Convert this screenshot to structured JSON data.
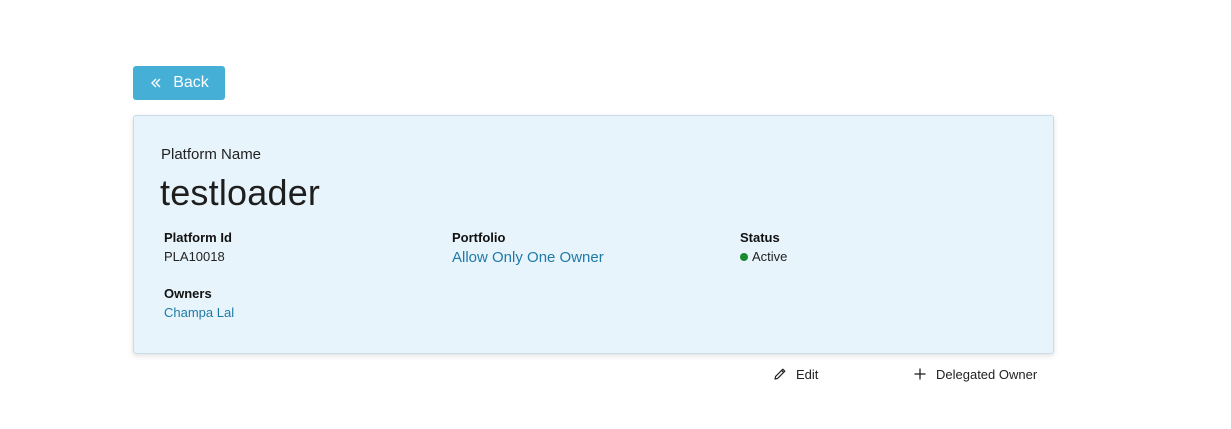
{
  "back_button": {
    "label": "Back",
    "icon": "double-chevron-left-icon"
  },
  "platform": {
    "name_label": "Platform Name",
    "name": "testloader",
    "fields": {
      "platform_id": {
        "label": "Platform Id",
        "value": "PLA10018"
      },
      "portfolio": {
        "label": "Portfolio",
        "value": "Allow Only One Owner"
      },
      "status": {
        "label": "Status",
        "value": "Active",
        "color": "#1b8a2f"
      },
      "owners": {
        "label": "Owners",
        "value": "Champa Lal"
      }
    }
  },
  "actions": {
    "edit": {
      "label": "Edit",
      "icon": "pencil-icon"
    },
    "delegated_owner": {
      "label": "Delegated Owner",
      "icon": "plus-icon"
    }
  },
  "colors": {
    "accent": "#45afd6",
    "card_bg": "#e8f4fb",
    "link": "#1f7aa8"
  }
}
